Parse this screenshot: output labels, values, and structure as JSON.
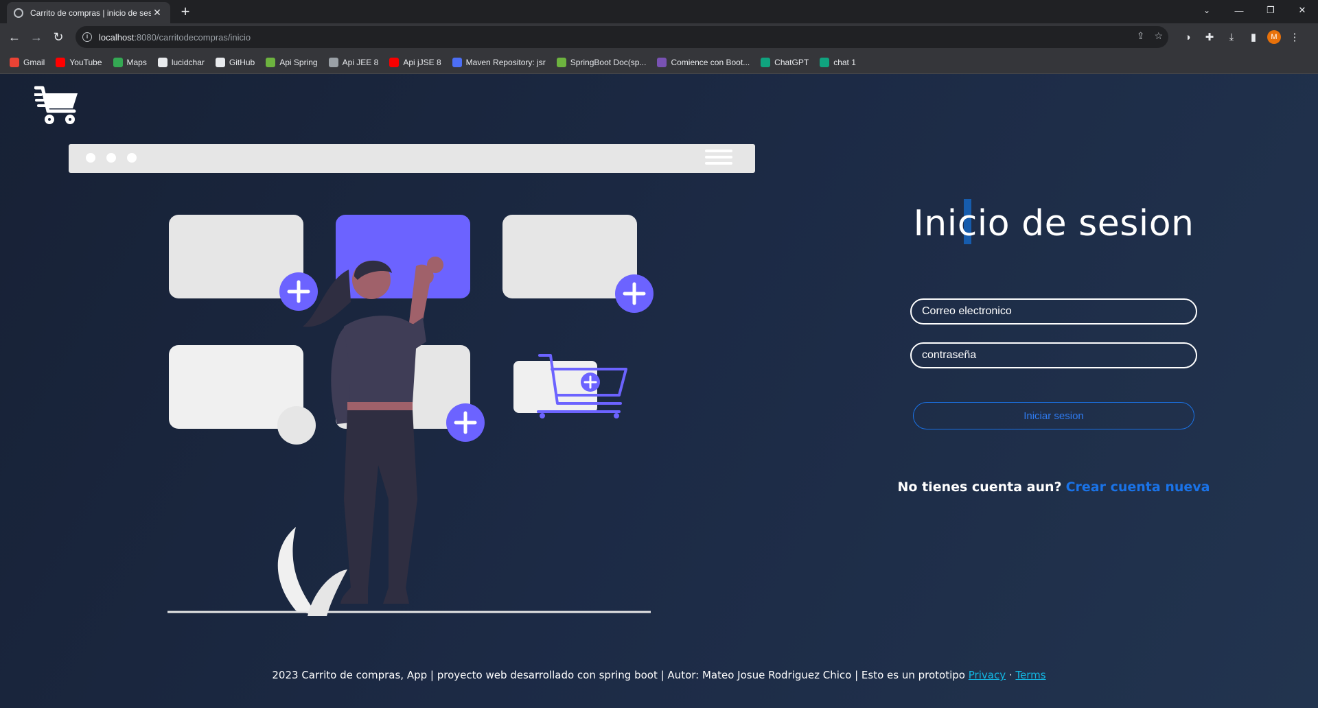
{
  "browser": {
    "tab_title": "Carrito de compras | inicio de sesion",
    "url_host": "localhost",
    "url_path": ":8080/carritodecompras/inicio",
    "profile_initial": "M",
    "bookmarks": [
      {
        "label": "Gmail",
        "icon": "gmail-icon",
        "color": "#ea4335"
      },
      {
        "label": "YouTube",
        "icon": "youtube-icon",
        "color": "#ff0000"
      },
      {
        "label": "Maps",
        "icon": "maps-icon",
        "color": "#34a853"
      },
      {
        "label": "lucidchar",
        "icon": "lucidchart-icon",
        "color": "#e8eaed"
      },
      {
        "label": "GitHub",
        "icon": "github-icon",
        "color": "#e8eaed"
      },
      {
        "label": "Api Spring",
        "icon": "spring-icon",
        "color": "#6db33f"
      },
      {
        "label": "Api JEE 8",
        "icon": "globe-icon",
        "color": "#9aa0a6"
      },
      {
        "label": "Api jJSE 8",
        "icon": "oracle-icon",
        "color": "#f80000"
      },
      {
        "label": "Maven Repository: jsr",
        "icon": "maven-icon",
        "color": "#4c6ef5"
      },
      {
        "label": "SpringBoot Doc(sp...",
        "icon": "spring-icon",
        "color": "#6db33f"
      },
      {
        "label": "Comience con Boot...",
        "icon": "bootstrap-icon",
        "color": "#7952b3"
      },
      {
        "label": "ChatGPT",
        "icon": "chatgpt-icon",
        "color": "#10a37f"
      },
      {
        "label": "chat 1",
        "icon": "chatgpt-icon",
        "color": "#10a37f"
      }
    ]
  },
  "login": {
    "title": "Inicio de sesion",
    "email_placeholder": "Correo electronico",
    "password_placeholder": "contraseña",
    "submit_label": "Iniciar sesion",
    "no_account_text": "No tienes cuenta aun?",
    "create_account_link": "Crear cuenta nueva"
  },
  "footer": {
    "text": "2023 Carrito de compras, App | proyecto web desarrollado con spring boot | Autor: Mateo Josue Rodriguez Chico | Esto es un prototipo",
    "privacy_link": "Privacy",
    "separator": "·",
    "terms_link": "Terms"
  },
  "colors": {
    "accent_purple": "#6c63ff",
    "link_blue": "#1a73e8",
    "footer_link": "#13b7e3"
  }
}
